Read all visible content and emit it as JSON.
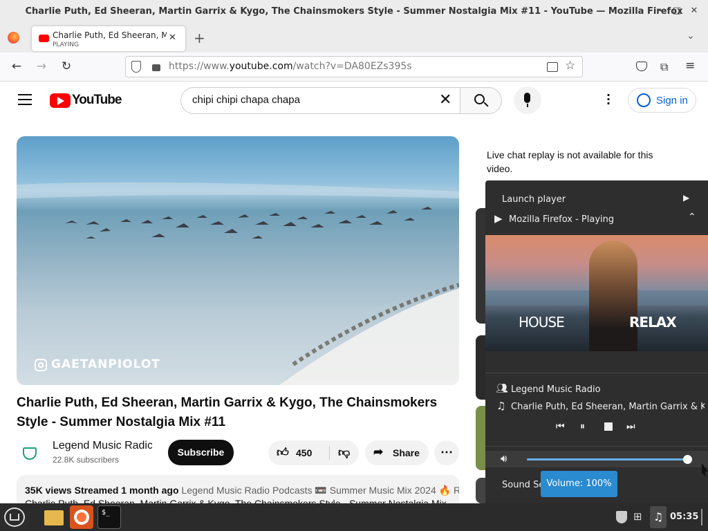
{
  "window": {
    "title": "Charlie Puth, Ed Sheeran, Martin Garrix & Kygo, The Chainsmokers Style - Summer Nostalgia Mix #11 - YouTube — Mozilla Firefox",
    "minimize": "–",
    "maximize": "□",
    "close": "✕"
  },
  "tab": {
    "title": "Charlie Puth, Ed Sheeran, M",
    "status": "PLAYING"
  },
  "nav": {
    "url_prefix": "https://www.",
    "url_domain": "youtube.com",
    "url_path": "/watch?v=DA80EZs395s"
  },
  "youtube": {
    "logo_text": "YouTube",
    "search_value": "chipi chipi chapa chapa",
    "sign_in": "Sign in",
    "video_watermark": "GAETANPIOLOT",
    "video_title": "Charlie Puth, Ed Sheeran, Martin Garrix & Kygo, The Chainsmokers Style - Summer Nostalgia Mix #11",
    "channel_name": "Legend Music Radic",
    "subscribers": "22.8K subscribers",
    "subscribe": "Subscribe",
    "likes": "450",
    "share": "Share",
    "desc_line1_bold": "35K views  Streamed 1 month ago",
    "desc_line1_rest": "Legend Music Radio Podcasts 📼 Summer Music Mix 2024 🔥 R",
    "desc_line2": "Charlie Puth, Ed Sheeran, Martin Garrix & Kygo, The Chainsmokers Style - Summer Nostalgia Mix",
    "chat_message": "Live chat replay is not available for this video."
  },
  "sound_popup": {
    "launch_player": "Launch player",
    "player_name": "Mozilla Firefox - Playing",
    "art_left": "HOUSE",
    "art_right": "RELAX",
    "artist": "Legend Music Radio",
    "track": "Charlie Puth, Ed Sheeran, Martin Garrix & K...",
    "volume_percent": 100,
    "sound_settings": "Sound Se",
    "volume_tooltip": "Volume: 100%"
  },
  "taskbar": {
    "clock": "05:35",
    "terminal_label": "$_"
  }
}
